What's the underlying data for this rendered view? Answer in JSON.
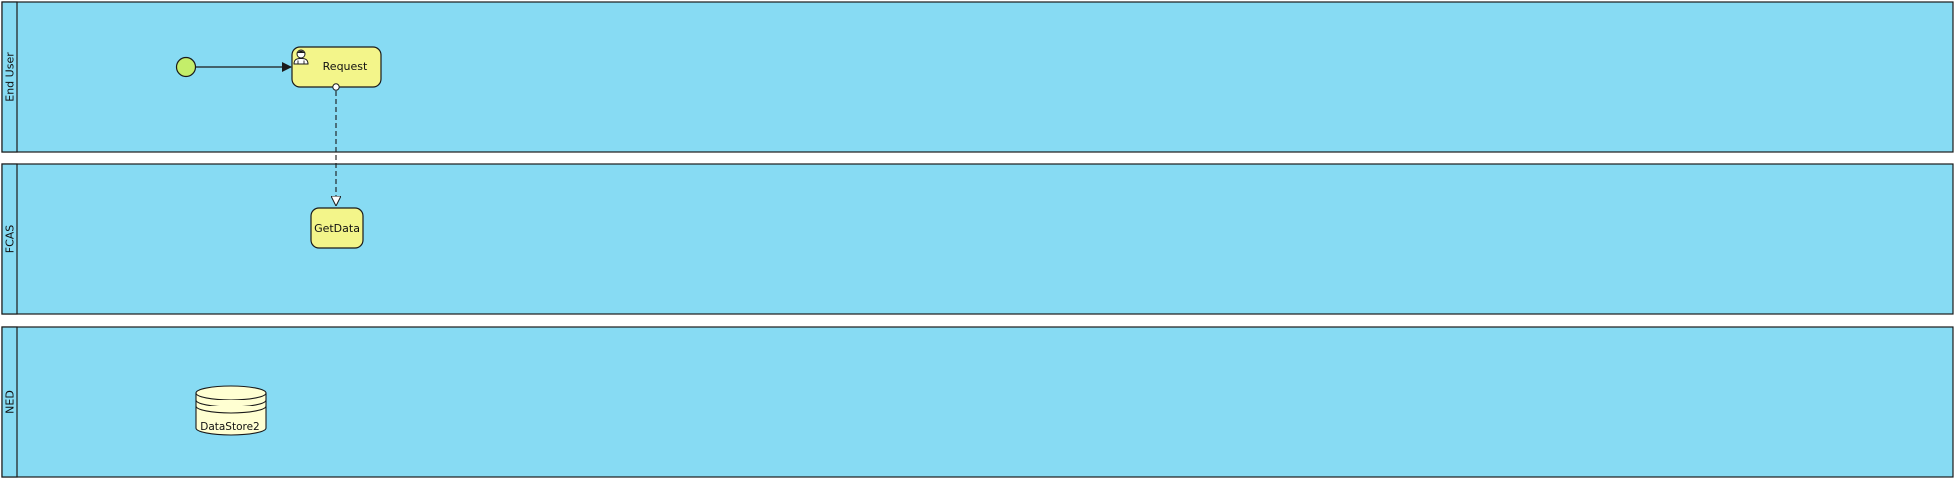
{
  "lanes": [
    {
      "name": "End User"
    },
    {
      "name": "FCAS"
    },
    {
      "name": "NED"
    }
  ],
  "tasks": {
    "request": {
      "label": "Request",
      "icon": "user-icon"
    },
    "getdata": {
      "label": "GetData"
    }
  },
  "data_store": {
    "label": "DataStore2"
  },
  "colors": {
    "lane": "#87dbf3",
    "task": "#f3f58a",
    "start_event": "#c4ee6a",
    "data_store": "#ffffd2"
  }
}
